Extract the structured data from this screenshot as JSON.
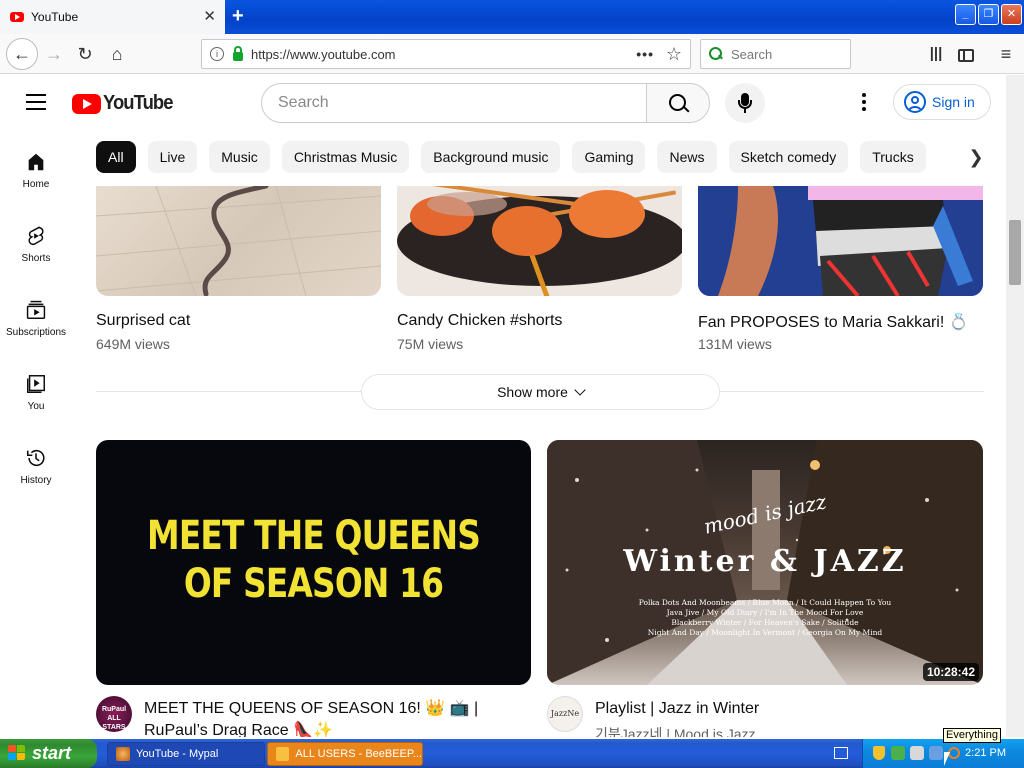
{
  "browser": {
    "tab_title": "YouTube",
    "tab_close": "✕",
    "new_tab": "+",
    "url": "https://www.youtube.com",
    "search_placeholder": "Search",
    "win_min": "_",
    "win_max": "❐",
    "win_close": "✕"
  },
  "header": {
    "logo_text": "YouTube",
    "search_placeholder": "Search",
    "signin_label": "Sign in"
  },
  "chips": [
    "All",
    "Live",
    "Music",
    "Christmas Music",
    "Background music",
    "Gaming",
    "News",
    "Sketch comedy",
    "Trucks"
  ],
  "rail": {
    "home": "Home",
    "shorts": "Shorts",
    "subscriptions": "Subscriptions",
    "you": "You",
    "history": "History"
  },
  "shorts": [
    {
      "title": "Surprised cat",
      "views": "649M views"
    },
    {
      "title": "Candy Chicken #shorts",
      "views": "75M views"
    },
    {
      "title": "Fan PROPOSES to Maria Sakkari! 💍",
      "views": "131M views"
    }
  ],
  "show_more": "Show more",
  "videos": [
    {
      "thumb_text_line1": "MEET THE QUEENS",
      "thumb_text_line2": "OF SEASON 16",
      "title_line1": "MEET THE QUEENS OF SEASON 16! 👑 📺 |",
      "title_line2": "RuPaul’s Drag Race 👠✨",
      "channel_avatar_text": "RuPaul ALL STARS"
    },
    {
      "thumb_script": "mood is jazz",
      "thumb_title": "Winter & JAZZ",
      "thumb_tracks": [
        "Polka Dots And Moonbeams / Blue Moon / It Could Happen To You",
        "Java Jive / My Old Diary / I'm In The Mood For Love",
        "Blackberry Winter / For Heaven's Sake / Solitude",
        "Night And Day / Moonlight In Vermont / Georgia On My Mind"
      ],
      "duration": "10:28:42",
      "title": "Playlist | Jazz in Winter",
      "channel": "기분Jazz네 | Mood is Jazz",
      "channel_avatar_text": "JazzNe"
    }
  ],
  "taskbar": {
    "start": "start",
    "task1": "YouTube - Mypal",
    "task2": "ALL USERS - BeeBEEP...",
    "clock": "2:21 PM",
    "tooltip": "Everything"
  },
  "colors": {
    "yt_red": "#ff0000",
    "link_blue": "#065fd4",
    "xp_blue": "#245dda",
    "xp_green": "#3aa63a"
  }
}
